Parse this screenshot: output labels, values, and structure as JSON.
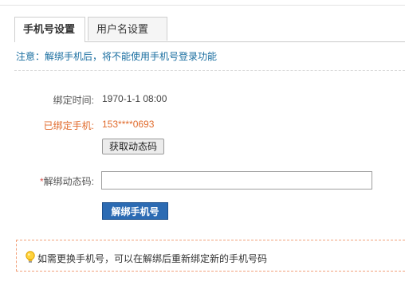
{
  "tabs": [
    {
      "label": "手机号设置",
      "active": true
    },
    {
      "label": "用户名设置",
      "active": false
    }
  ],
  "notice": "注意：解绑手机后，将不能使用手机号登录功能",
  "bind_time": {
    "label": "绑定时间:",
    "value": "1970-1-1 08:00"
  },
  "bound_phone": {
    "label": "已绑定手机:",
    "value": "153****0693",
    "color": "#e06a2b"
  },
  "get_code_button": "获取动态码",
  "unbind_code": {
    "required_mark": "*",
    "label": "解绑动态码:",
    "value": "",
    "placeholder": ""
  },
  "unbind_button": "解绑手机号",
  "tip": {
    "icon": "lightbulb-icon",
    "text": "如需更换手机号，可以在解绑后重新绑定新的手机号码"
  },
  "colors": {
    "accent_blue": "#2c6bb3",
    "notice_blue": "#1a6ea0",
    "warning_orange": "#e06a2b"
  }
}
